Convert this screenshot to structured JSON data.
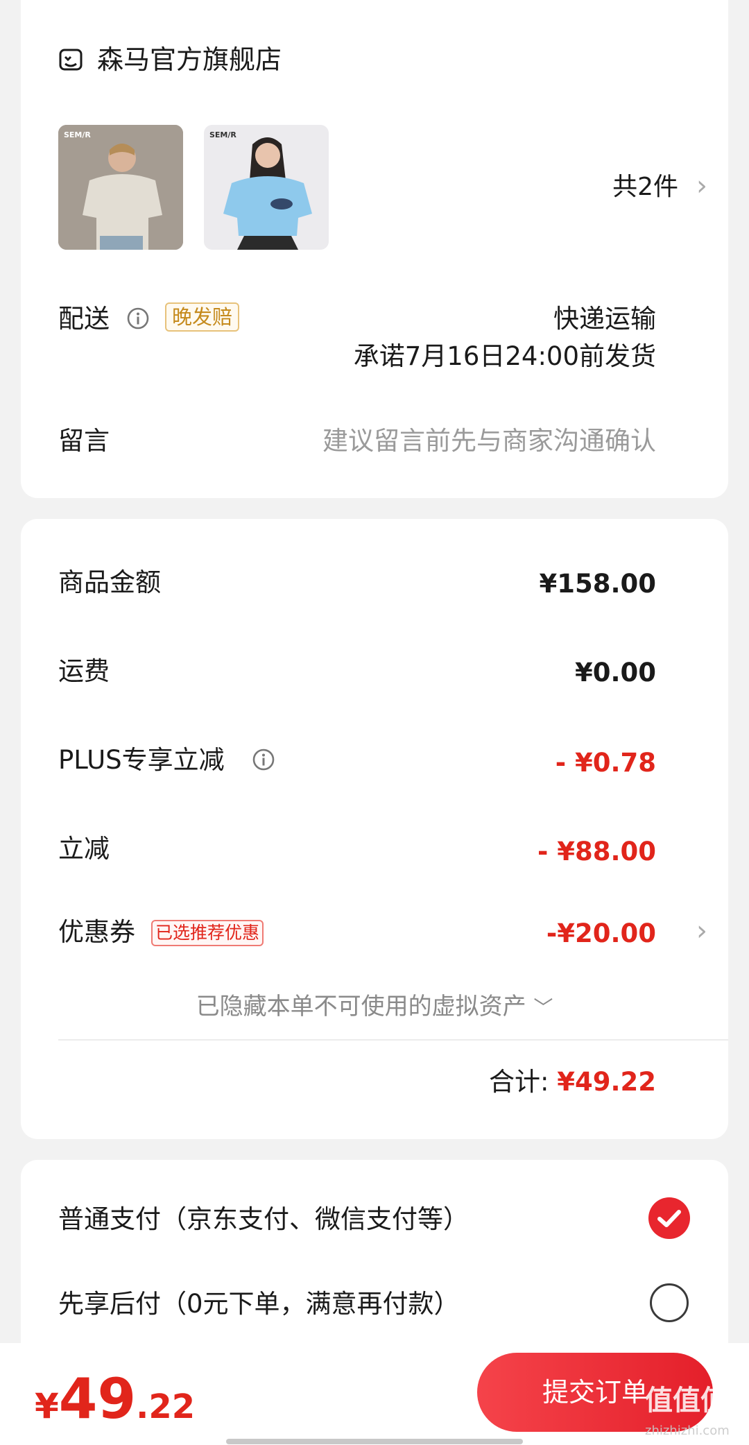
{
  "store": {
    "name": "森马官方旗舰店",
    "icon": "store-icon"
  },
  "products": {
    "count_label": "共2件",
    "items": [
      {
        "brand_mark": "SEM/R",
        "shirt_color": "#e2ddd3"
      },
      {
        "brand_mark": "SEM/R",
        "shirt_color": "#8ec9ec"
      }
    ]
  },
  "delivery": {
    "label": "配送",
    "badge": "晚发赔",
    "method": "快递运输",
    "promise": "承诺7月16日24:00前发货"
  },
  "message": {
    "label": "留言",
    "placeholder": "建议留言前先与商家沟通确认"
  },
  "price": {
    "goods_label": "商品金额",
    "goods_value": "¥158.00",
    "shipping_label": "运费",
    "shipping_value": "¥0.00",
    "plus_label": "PLUS专享立减",
    "plus_value": "- ¥0.78",
    "discount_label": "立减",
    "discount_value": "- ¥88.00",
    "coupon_label": "优惠券",
    "coupon_badge": "已选推荐优惠",
    "coupon_value": "-¥20.00",
    "hidden_assets": "已隐藏本单不可使用的虚拟资产",
    "total_label": "合计:",
    "total_value": "¥49.22"
  },
  "payment": {
    "options": [
      {
        "label": "普通支付（京东支付、微信支付等）",
        "selected": true
      },
      {
        "label": "先享后付（0元下单，满意再付款）",
        "selected": false
      }
    ]
  },
  "bottom": {
    "currency": "¥",
    "total_int": "49",
    "total_dec": ".22",
    "submit": "提交订单",
    "watermark": "值值值",
    "watermark_url": "zhizhizhi.com"
  },
  "colors": {
    "accent": "#e1251b",
    "button": "#e8262e",
    "tag_orange": "#c58a1c"
  }
}
